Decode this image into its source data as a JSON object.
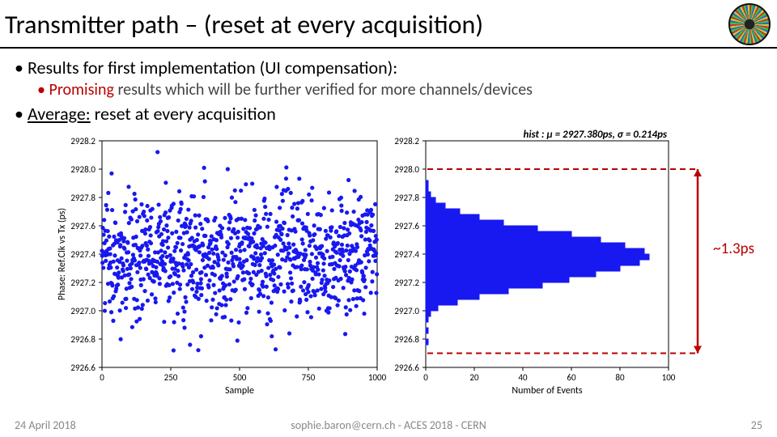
{
  "title": "Transmitter path – (reset at every acquisition)",
  "bullets": {
    "b1a": "Results for first implementation (UI compensation):",
    "b2a_hl": "Promising",
    "b2a_rest": " results which will be further verified for more channels/devices",
    "b1b_under": "Average:",
    "b1b_rest": " reset at every acquisition"
  },
  "annotation": "~1.3ps",
  "footer": {
    "left": "24 April 2018",
    "mid": "sophie.baron@cern.ch - ACES 2018 - CERN",
    "right": "25"
  },
  "chart_data": [
    {
      "type": "scatter",
      "title": "",
      "xlabel": "Sample",
      "ylabel": "Phase: Ref.Clk vs Tx (ps)",
      "xlim": [
        0,
        1000
      ],
      "ylim": [
        2926.6,
        2928.2
      ],
      "xticks": [
        0,
        250,
        500,
        750,
        1000
      ],
      "yticks": [
        2926.6,
        2926.8,
        2927.0,
        2927.2,
        2927.4,
        2927.6,
        2927.8,
        2928.0,
        2928.2
      ],
      "series": [
        {
          "name": "phase",
          "color": "#1818f0",
          "note": "~1000 points clustered 2927.0–2927.8, mean ≈2927.38, sigma≈0.21; few low outliers 2926.7–2926.9 near x≈250–350"
        }
      ]
    },
    {
      "type": "hist-horizontal",
      "title": "hist : μ = 2927.380ps, σ = 0.214ps",
      "xlabel": "Number of Events",
      "ylabel": "",
      "xlim": [
        0,
        100
      ],
      "ylim": [
        2926.6,
        2928.2
      ],
      "xticks": [
        0,
        20,
        40,
        60,
        80,
        100
      ],
      "yticks": [
        2926.6,
        2926.8,
        2927.0,
        2927.2,
        2927.4,
        2927.6,
        2927.8,
        2928.0,
        2928.2
      ],
      "bin_edges": [
        2926.68,
        2926.72,
        2926.76,
        2926.8,
        2926.84,
        2926.88,
        2926.92,
        2926.96,
        2927.0,
        2927.04,
        2927.08,
        2927.12,
        2927.16,
        2927.2,
        2927.24,
        2927.28,
        2927.32,
        2927.36,
        2927.4,
        2927.44,
        2927.48,
        2927.52,
        2927.56,
        2927.6,
        2927.64,
        2927.68,
        2927.72,
        2927.76,
        2927.8,
        2927.84,
        2927.88,
        2927.92,
        2927.96,
        2928.0
      ],
      "counts": [
        0,
        0,
        1,
        0,
        1,
        0,
        1,
        2,
        5,
        13,
        22,
        34,
        48,
        59,
        70,
        80,
        88,
        92,
        90,
        82,
        72,
        60,
        46,
        32,
        22,
        14,
        8,
        4,
        2,
        1,
        1,
        0,
        0
      ],
      "span_markers": {
        "top_y": 2928.0,
        "bottom_y": 2926.7,
        "label": "~1.3ps"
      }
    }
  ]
}
